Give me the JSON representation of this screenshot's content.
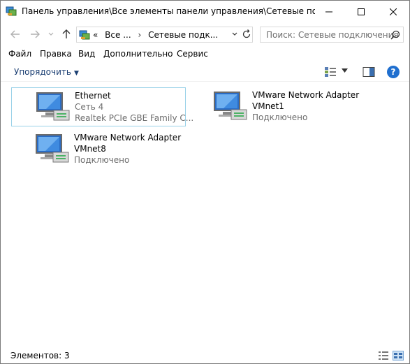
{
  "window": {
    "title": "Панель управления\\Все элементы панели управления\\Сетевые подключения"
  },
  "address": {
    "crumbs": [
      "«",
      "Все ...",
      "›",
      "Сетевые подк..."
    ],
    "search_placeholder": "Поиск: Сетевые подключения"
  },
  "menu": {
    "items": [
      {
        "label": "Файл"
      },
      {
        "label": "Правка"
      },
      {
        "label": "Вид"
      },
      {
        "label": "Дополнительно"
      },
      {
        "label": "Сервис"
      }
    ]
  },
  "commandbar": {
    "organize_label": "Упорядочить"
  },
  "connections": [
    {
      "name": "Ethernet",
      "line2": "Сеть 4",
      "line3": "Realtek PCIe GBE Family C...",
      "selected": true
    },
    {
      "name": "VMware Network Adapter",
      "line2": "VMnet1",
      "line3": "Подключено",
      "selected": false
    },
    {
      "name": "VMware Network Adapter",
      "line2": "VMnet8",
      "line3": "Подключено",
      "selected": false
    }
  ],
  "status": {
    "items_text": "Элементов: 3"
  },
  "colors": {
    "accent": "#1f6fcf",
    "selection_border": "#99d1e8",
    "secondary_text": "#6d6d6d"
  }
}
